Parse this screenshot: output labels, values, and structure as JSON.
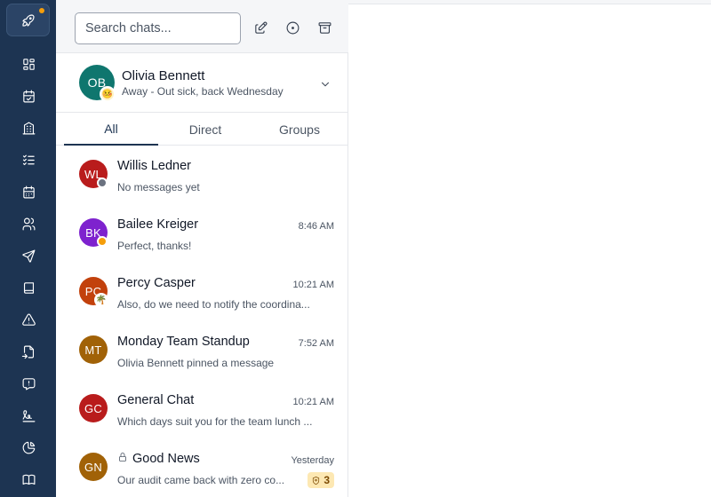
{
  "rail": {
    "logo_icon": "rocket-icon",
    "notification_color": "#f59e0b",
    "items": [
      {
        "icon": "dashboard-icon"
      },
      {
        "icon": "calendar-check-icon"
      },
      {
        "icon": "building-icon"
      },
      {
        "icon": "checklist-icon"
      },
      {
        "icon": "calendar-icon"
      },
      {
        "icon": "users-icon"
      },
      {
        "icon": "send-icon"
      },
      {
        "icon": "book-icon"
      },
      {
        "icon": "warning-icon"
      },
      {
        "icon": "file-import-icon"
      },
      {
        "icon": "message-alert-icon"
      },
      {
        "icon": "signature-icon"
      },
      {
        "icon": "pie-chart-icon"
      },
      {
        "icon": "book-open-icon"
      }
    ]
  },
  "search": {
    "placeholder": "Search chats..."
  },
  "toolbar": {
    "icons": [
      "compose-icon",
      "status-circle-icon",
      "archive-icon"
    ]
  },
  "profile": {
    "initials": "OB",
    "name": "Olivia Bennett",
    "status": "Away - Out sick, back Wednesday",
    "avatar_color": "#0f766e",
    "status_emoji": "🤒"
  },
  "tabs": [
    {
      "label": "All",
      "active": true
    },
    {
      "label": "Direct",
      "active": false
    },
    {
      "label": "Groups",
      "active": false
    }
  ],
  "chats": [
    {
      "initials": "WL",
      "name": "Willis Ledner",
      "time": "",
      "preview": "No messages yet",
      "avatar_color": "#b91c1c",
      "presence": "offline",
      "presence_color": "#6b7280"
    },
    {
      "initials": "BK",
      "name": "Bailee Kreiger",
      "time": "8:46 AM",
      "preview": "Perfect, thanks!",
      "avatar_color": "#7e22ce",
      "presence": "away",
      "presence_color": "#f59e0b"
    },
    {
      "initials": "PC",
      "name": "Percy Casper",
      "time": "10:21 AM",
      "preview": "Also, do we need to notify the coordina...",
      "avatar_color": "#c2410c",
      "presence": "vacation",
      "presence_emoji": "🌴"
    },
    {
      "initials": "MT",
      "name": "Monday Team Standup",
      "time": "7:52 AM",
      "preview": "Olivia Bennett pinned a message",
      "avatar_color": "#a16207"
    },
    {
      "initials": "GC",
      "name": "General Chat",
      "time": "10:21 AM",
      "preview": "Which days suit you for the team lunch ...",
      "avatar_color": "#b91c1c"
    },
    {
      "initials": "GN",
      "name": "Good News",
      "time": "Yesterday",
      "preview": "Our audit came back with zero co...",
      "avatar_color": "#a16207",
      "locked": true,
      "unread": "3",
      "badge_color": "#fde8b3"
    }
  ]
}
